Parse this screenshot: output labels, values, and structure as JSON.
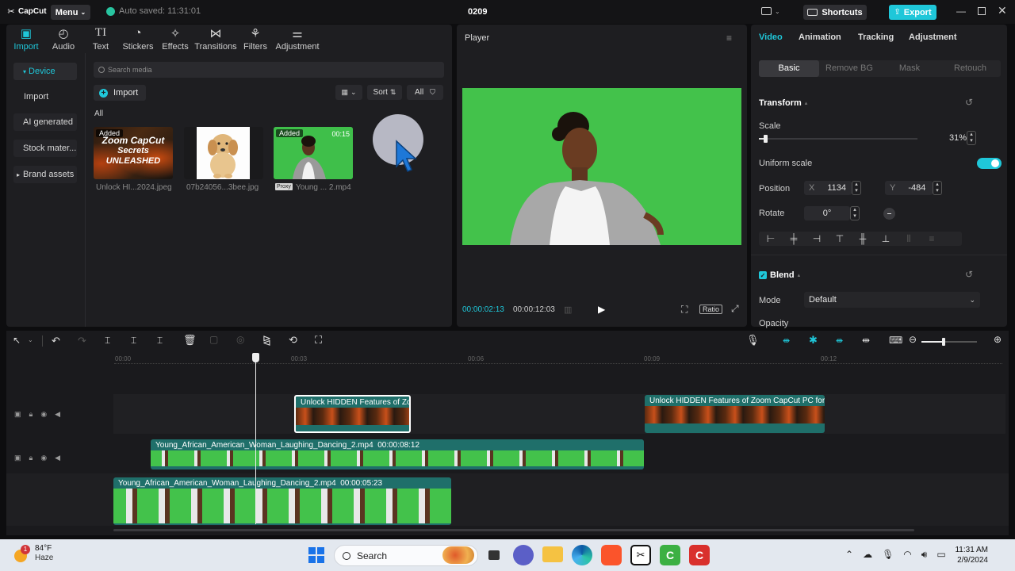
{
  "app": {
    "name": "CapCut",
    "menu_label": "Menu",
    "autosave": "Auto saved: 11:31:01",
    "project_title": "0209",
    "shortcuts_label": "Shortcuts",
    "export_label": "Export"
  },
  "toolbar_tabs": [
    {
      "label": "Import",
      "icon": "import-icon",
      "active": true
    },
    {
      "label": "Audio",
      "icon": "audio-icon"
    },
    {
      "label": "Text",
      "icon": "text-icon"
    },
    {
      "label": "Stickers",
      "icon": "stickers-icon"
    },
    {
      "label": "Effects",
      "icon": "effects-icon"
    },
    {
      "label": "Transitions",
      "icon": "transitions-icon"
    },
    {
      "label": "Filters",
      "icon": "filters-icon"
    },
    {
      "label": "Adjustment",
      "icon": "adjustment-icon"
    }
  ],
  "sidebar": {
    "items": [
      "Device",
      "Import",
      "AI generated",
      "Stock mater...",
      "Brand assets"
    ]
  },
  "media": {
    "search_placeholder": "Search media",
    "import_label": "Import",
    "sort_label": "Sort",
    "filter_label": "All",
    "section_label": "All",
    "items": [
      {
        "name": "Unlock HI...2024.jpeg",
        "badge": "Added",
        "thumb_line1": "Zoom CapCut",
        "thumb_line2": "Secrets",
        "thumb_line3": "UNLEASHED"
      },
      {
        "name": "07b24056...3bee.jpg"
      },
      {
        "name": "Young ... 2.mp4",
        "badge": "Added",
        "duration": "00:15",
        "proxy": "Proxy"
      }
    ]
  },
  "player": {
    "title": "Player",
    "current_time": "00:00:02:13",
    "total_time": "00:00:12:03",
    "ratio_label": "Ratio"
  },
  "inspector": {
    "tabs": [
      "Video",
      "Animation",
      "Tracking",
      "Adjustment"
    ],
    "subtabs": [
      "Basic",
      "Remove BG",
      "Mask",
      "Retouch"
    ],
    "transform_label": "Transform",
    "scale_label": "Scale",
    "scale_value": "31%",
    "scale_level": 0.03,
    "uniform_scale_label": "Uniform scale",
    "position_label": "Position",
    "pos_x_label": "X",
    "pos_x": "1134",
    "pos_y_label": "Y",
    "pos_y": "-484",
    "rotate_label": "Rotate",
    "rotate_value": "0°",
    "blend_label": "Blend",
    "mode_label": "Mode",
    "mode_value": "Default",
    "opacity_label": "Opacity"
  },
  "timeline": {
    "ruler": [
      "00:00",
      "00:03",
      "00:06",
      "00:09",
      "00:12"
    ],
    "clips": [
      {
        "label": "Unlock HIDDEN Features of Zoo"
      },
      {
        "label": "Unlock HIDDEN Features of Zoom CapCut PC for S"
      },
      {
        "label": "Young_African_American_Woman_Laughing_Dancing_2.mp4",
        "duration": "00:00:08:12"
      },
      {
        "label": "Young_African_American_Woman_Laughing_Dancing_2.mp4",
        "duration": "00:00:05:23"
      }
    ]
  },
  "taskbar": {
    "temp": "84°F",
    "weather": "Haze",
    "search_label": "Search",
    "time": "11:31 AM",
    "date": "2/9/2024",
    "notif_count": "1"
  },
  "colors": {
    "accent": "#1fc7d9",
    "green_screen": "#3fbf4a",
    "clip_teal": "#1f6f6a"
  }
}
